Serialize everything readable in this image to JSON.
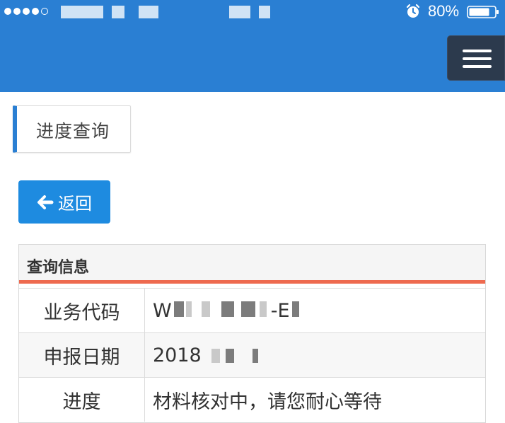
{
  "status_bar": {
    "battery_percent": "80%",
    "battery_level": 0.8,
    "signal_bars": 5,
    "signal_filled": 4,
    "icons": [
      "signal-dots-icon",
      "alarm-icon",
      "battery-icon"
    ]
  },
  "header": {
    "menu_icon": "hamburger-menu-icon"
  },
  "page": {
    "title": "进度查询",
    "back_button_label": "返回",
    "back_icon": "arrow-left-icon"
  },
  "info": {
    "heading": "查询信息",
    "rows": [
      {
        "label": "业务代码",
        "value_prefix": "W",
        "value_suffix": "-E"
      },
      {
        "label": "申报日期",
        "value_prefix": "2018",
        "value_suffix": ""
      },
      {
        "label": "进度",
        "value_prefix": "材料核对中，请您耐心等待",
        "value_suffix": ""
      }
    ]
  },
  "colors": {
    "primary": "#2a7fd3",
    "button": "#1e8be0",
    "menu_button": "#2c3a4d",
    "table_accent": "#ee6a4f"
  }
}
